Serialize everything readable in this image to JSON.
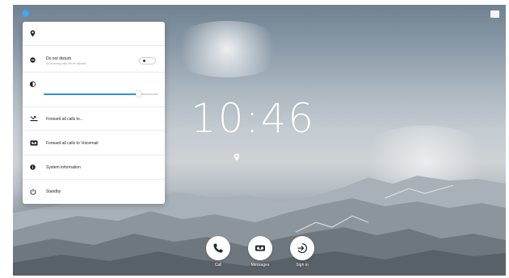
{
  "clock": {
    "time": "10:46"
  },
  "panel": {
    "dnd": {
      "label": "Do not disturb",
      "sublabel": "All incoming calls will be rejected",
      "enabled": false
    },
    "volume": {
      "level": 0.83
    },
    "forward_all": {
      "label": "Forward all calls to..."
    },
    "forward_voicemail": {
      "label": "Forward all calls to Voicemail"
    },
    "system_info": {
      "label": "System information"
    },
    "standby": {
      "label": "Standby"
    }
  },
  "actions": [
    {
      "label": "Call",
      "icon": "phone-icon"
    },
    {
      "label": "Messages",
      "icon": "voicemail-icon"
    },
    {
      "label": "Sign in",
      "icon": "sign-in-icon"
    }
  ],
  "colors": {
    "accent": "#2f8de4",
    "settings_dot": "#3fa9f5"
  }
}
